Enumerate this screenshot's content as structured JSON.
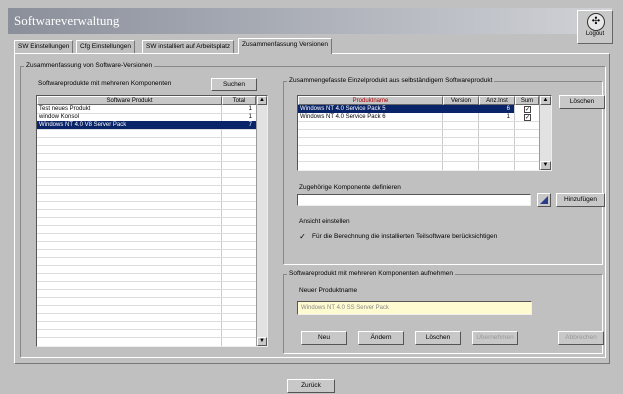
{
  "window": {
    "title": "Softwareverwaltung"
  },
  "logo_button": {
    "label": "Logout",
    "icon": "logo-icon"
  },
  "tabs": [
    {
      "label": "SW Einstellungen"
    },
    {
      "label": "Cfg Einstellungen"
    },
    {
      "label": "SW installiert auf Arbeitsplatz"
    },
    {
      "label": "Zusammenfassung Versionen"
    }
  ],
  "main_group": {
    "label": "Zusammenfassung von Software-Versionen"
  },
  "left": {
    "label": "Softwareprodukte mit mehreren Komponenten",
    "search_button": "Suchen",
    "columns": [
      "Software Produkt",
      "Total"
    ],
    "rows": [
      {
        "product": "Test neues Produkt",
        "total": "1"
      },
      {
        "product": "window Konsol",
        "total": "1"
      },
      {
        "product": "Windows NT 4.0 V8 Server Pack",
        "total": "7",
        "selected": true
      }
    ]
  },
  "right_top": {
    "label": "Zusammengefasste Einzelprodukt aus selbständigem Softwareprodukt",
    "columns": [
      "Produktname",
      "Version",
      "Anz.Inst",
      "Sum"
    ],
    "rows": [
      {
        "name": "Windows NT 4.0 Service Pack 5",
        "version": "",
        "count": "6",
        "checked": true,
        "selected": true
      },
      {
        "name": "Windows NT 4.0 Service Pack 6",
        "version": "",
        "count": "1",
        "checked": true,
        "selected": false
      }
    ],
    "delete_button": "Löschen",
    "add_label": "Zugehörige Komponente definieren",
    "add_button": "Hinzufügen",
    "display_label": "Ansicht einstellen",
    "checkbox_label": "Für die Berechnung die installierten Teilsoftware berücksichtigen"
  },
  "right_bottom": {
    "label": "Softwareprodukt mit mehreren Komponenten aufnehmen",
    "name_label": "Neuer Produktname",
    "name_value": "Windows NT 4.0 SS Server Pack",
    "buttons": {
      "new": "Neu",
      "change": "Ändern",
      "delete": "Löschen",
      "disabled1": "Übernehmen",
      "disabled2": "Abbrechen"
    }
  },
  "back_button": "Zurück"
}
